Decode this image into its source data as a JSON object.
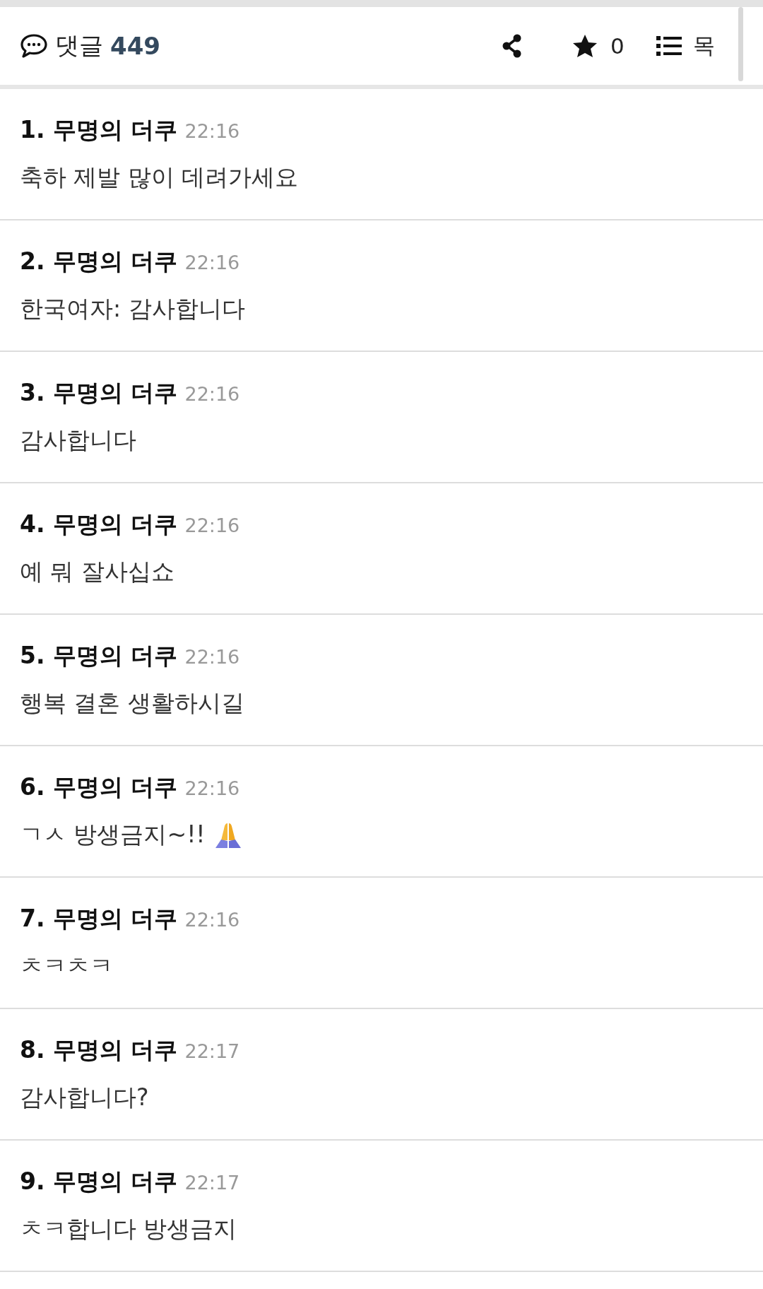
{
  "header": {
    "label": "댓글",
    "count": "449",
    "stars": "0",
    "list_label": "목"
  },
  "comments": [
    {
      "number": "1.",
      "author": "무명의 더쿠",
      "time": "22:16",
      "text": "축하 제발 많이 데려가세요",
      "emoji": false
    },
    {
      "number": "2.",
      "author": "무명의 더쿠",
      "time": "22:16",
      "text": "한국여자: 감사합니다",
      "emoji": false
    },
    {
      "number": "3.",
      "author": "무명의 더쿠",
      "time": "22:16",
      "text": "감사합니다",
      "emoji": false
    },
    {
      "number": "4.",
      "author": "무명의 더쿠",
      "time": "22:16",
      "text": "예 뭐 잘사십쇼",
      "emoji": false
    },
    {
      "number": "5.",
      "author": "무명의 더쿠",
      "time": "22:16",
      "text": "행복 결혼 생활하시길",
      "emoji": false
    },
    {
      "number": "6.",
      "author": "무명의 더쿠",
      "time": "22:16",
      "text": "ㄱㅅ 방생금지~!!",
      "emoji": true
    },
    {
      "number": "7.",
      "author": "무명의 더쿠",
      "time": "22:16",
      "text": "ㅊㅋㅊㅋ",
      "emoji": false
    },
    {
      "number": "8.",
      "author": "무명의 더쿠",
      "time": "22:17",
      "text": "감사합니다?",
      "emoji": false
    },
    {
      "number": "9.",
      "author": "무명의 더쿠",
      "time": "22:17",
      "text": "ㅊㅋ합니다 방생금지",
      "emoji": false
    }
  ]
}
